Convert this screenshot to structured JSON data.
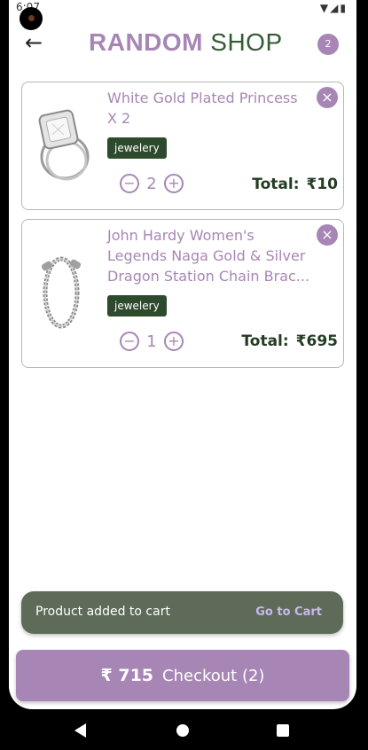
{
  "status_bar": {
    "time": "6:07"
  },
  "header": {
    "brand_part1": "RANDOM",
    "brand_part2": "SHOP",
    "cart_count": "2"
  },
  "cart": {
    "items": [
      {
        "name": "White Gold Plated Princess X 2",
        "category": "jewelery",
        "quantity": "2",
        "total_label": "Total:",
        "total_value": "₹10"
      },
      {
        "name": "John Hardy Women's Legends Naga Gold & Silver Dragon Station Chain Brac...",
        "category": "jewelery",
        "quantity": "1",
        "total_label": "Total:",
        "total_value": "₹695"
      }
    ]
  },
  "snackbar": {
    "message": "Product added to cart",
    "action": "Go to Cart"
  },
  "checkout": {
    "price": "₹ 715",
    "label": "Checkout (2)"
  },
  "colors": {
    "accent": "#a786b5",
    "brand_green": "#345c34",
    "tag": "#2d4a2d",
    "snackbar": "#5e6b58"
  }
}
